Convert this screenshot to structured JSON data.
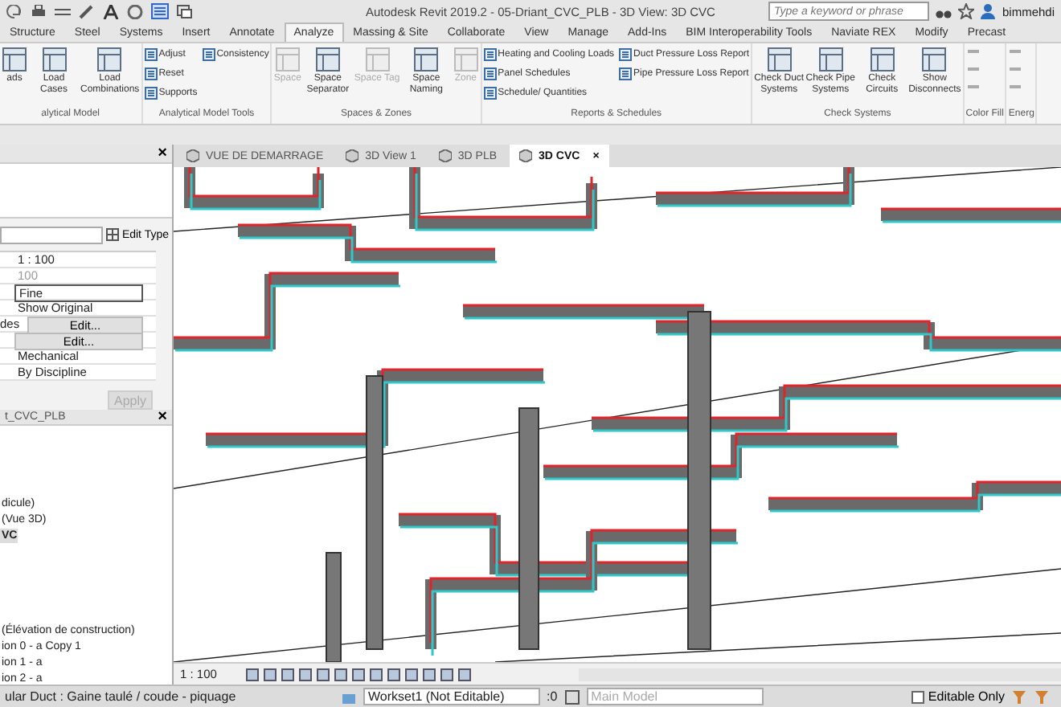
{
  "title_bar": {
    "title": "Autodesk Revit 2019.2 - 05-Driant_CVC_PLB - 3D View: 3D CVC",
    "search": {
      "placeholder": "Type a keyword or phrase"
    },
    "user": "bimmehdi"
  },
  "ribbon_tabs": [
    {
      "label": "Structure",
      "selected": false
    },
    {
      "label": "Steel",
      "selected": false
    },
    {
      "label": "Systems",
      "selected": false
    },
    {
      "label": "Insert",
      "selected": false
    },
    {
      "label": "Annotate",
      "selected": false
    },
    {
      "label": "Analyze",
      "selected": true
    },
    {
      "label": "Massing & Site",
      "selected": false
    },
    {
      "label": "Collaborate",
      "selected": false
    },
    {
      "label": "View",
      "selected": false
    },
    {
      "label": "Manage",
      "selected": false
    },
    {
      "label": "Add-Ins",
      "selected": false
    },
    {
      "label": "BIM Interoperability Tools",
      "selected": false
    },
    {
      "label": "Naviate REX",
      "selected": false
    },
    {
      "label": "Modify",
      "selected": false
    },
    {
      "label": "Precast",
      "selected": false
    }
  ],
  "ribbon_panels": [
    {
      "label": "alytical Model",
      "buttons": [
        {
          "label": "ads",
          "kind": "large",
          "disabled": false
        },
        {
          "label": "Load Cases",
          "kind": "large",
          "disabled": false
        },
        {
          "label": "Load Combinations",
          "kind": "large",
          "disabled": false
        }
      ]
    },
    {
      "label": "Analytical Model Tools",
      "buttons": [
        {
          "label": "Adjust",
          "kind": "small",
          "disabled": false
        },
        {
          "label": "Reset",
          "kind": "small",
          "disabled": false
        },
        {
          "label": "Supports",
          "kind": "small",
          "disabled": false
        },
        {
          "label": "Consistency",
          "kind": "small",
          "disabled": false
        }
      ]
    },
    {
      "label": "Spaces & Zones",
      "buttons": [
        {
          "label": "Space",
          "kind": "large",
          "disabled": true
        },
        {
          "label": "Space Separator",
          "kind": "large",
          "disabled": false
        },
        {
          "label": "Space Tag",
          "kind": "large",
          "disabled": true
        },
        {
          "label": "Space Naming",
          "kind": "large",
          "disabled": false
        },
        {
          "label": "Zone",
          "kind": "large",
          "disabled": true
        }
      ]
    },
    {
      "label": "Reports & Schedules",
      "buttons": [
        {
          "label": "Heating and Cooling Loads",
          "kind": "small",
          "disabled": false
        },
        {
          "label": "Panel Schedules",
          "kind": "small",
          "disabled": false
        },
        {
          "label": "Schedule/ Quantities",
          "kind": "small",
          "disabled": false
        },
        {
          "label": "Duct Pressure Loss Report",
          "kind": "small",
          "disabled": false
        },
        {
          "label": "Pipe Pressure Loss Report",
          "kind": "small",
          "disabled": false
        }
      ]
    },
    {
      "label": "Check Systems",
      "buttons": [
        {
          "label": "Check Duct Systems",
          "kind": "large",
          "disabled": false
        },
        {
          "label": "Check Pipe Systems",
          "kind": "large",
          "disabled": false
        },
        {
          "label": "Check Circuits",
          "kind": "large",
          "disabled": false
        },
        {
          "label": "Show Disconnects",
          "kind": "large",
          "disabled": false
        }
      ]
    },
    {
      "label": "Color Fill"
    },
    {
      "label": "Energ"
    }
  ],
  "properties": {
    "close": "×",
    "edit_type": "Edit Type",
    "rows": [
      {
        "value": "1 : 100",
        "kind": "text"
      },
      {
        "value": "100",
        "kind": "readonly"
      },
      {
        "value": "Fine",
        "kind": "field"
      },
      {
        "value": "Show Original",
        "kind": "text"
      },
      {
        "label": "des",
        "value": "Edit...",
        "kind": "button"
      },
      {
        "value": "Edit...",
        "kind": "button"
      },
      {
        "value": "Mechanical",
        "kind": "text"
      },
      {
        "value": "By Discipline",
        "kind": "text"
      }
    ],
    "apply": "Apply"
  },
  "project_browser": {
    "title": "t_CVC_PLB",
    "close": "×",
    "items": [
      {
        "label": "dicule)",
        "selected": false
      },
      {
        "label": "(Vue 3D)",
        "selected": false
      },
      {
        "label": "VC",
        "selected": true
      },
      {
        "label": "(Élévation de construction)",
        "selected": false
      },
      {
        "label": "ion 0 - a Copy 1",
        "selected": false
      },
      {
        "label": "ion 1 - a",
        "selected": false
      },
      {
        "label": "ion 2 - a",
        "selected": false
      }
    ]
  },
  "view_tabs": [
    {
      "label": "VUE DE DEMARRAGE",
      "selected": false
    },
    {
      "label": "3D View 1",
      "selected": false
    },
    {
      "label": "3D PLB",
      "selected": false
    },
    {
      "label": "3D CVC",
      "selected": true,
      "close": "×"
    }
  ],
  "view_bar": {
    "scale": "1 : 100"
  },
  "status_bar": {
    "message": "ular Duct : Gaine taulé / coude - piquage",
    "workset": "Workset1 (Not Editable)",
    "count": ":0",
    "model": "Main Model",
    "editable_only": {
      "label": "Editable Only",
      "checked": false
    }
  }
}
